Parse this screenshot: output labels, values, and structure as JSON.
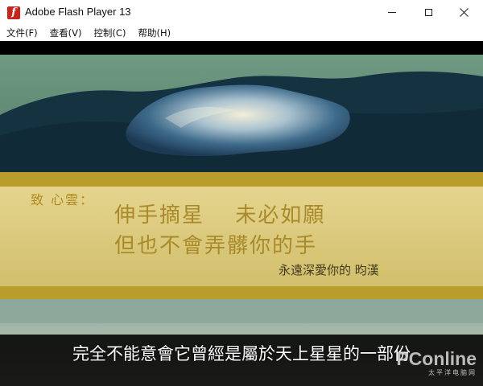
{
  "window": {
    "title": "Adobe Flash Player 13",
    "app_icon": "flash-player-icon",
    "app_icon_glyph": "f",
    "controls": {
      "minimize_icon": "minimize-icon",
      "maximize_icon": "maximize-icon",
      "close_icon": "close-icon",
      "close_glyph": "✕"
    }
  },
  "menubar": {
    "items": [
      {
        "label": "文件(F)"
      },
      {
        "label": "查看(V)"
      },
      {
        "label": "控制(C)"
      },
      {
        "label": "帮助(H)"
      }
    ]
  },
  "stage": {
    "greeting": "致 心雲：",
    "poem_lines": [
      "伸手摘星　 未必如願",
      "但也不會弄髒你的手"
    ],
    "signature": "永遠深愛你的 昀漢",
    "subtitle": "完全不能意會它曾經是屬於天上星星的一部份",
    "watermark": {
      "logo": "PConline",
      "sub": "太平洋电脑网"
    }
  },
  "colors": {
    "accent_red": "#c8241c",
    "gold_text": "#a88a2a",
    "panel_yellow": "#d9c77c",
    "panel_gold_band": "#b89d2c"
  }
}
